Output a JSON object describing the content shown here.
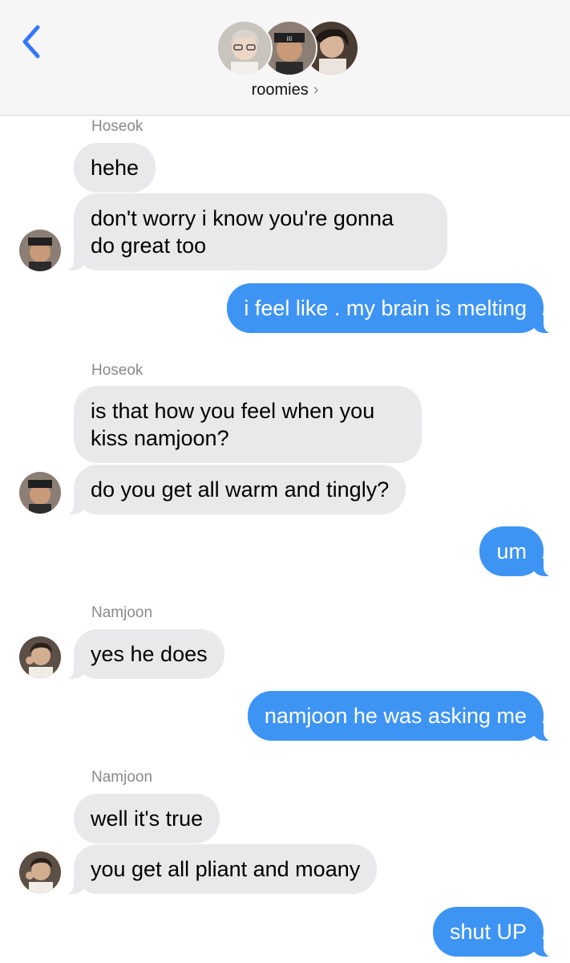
{
  "header": {
    "group_name": "roomies",
    "chevron": "›",
    "back_icon": "chevron-left-icon",
    "accent": "#3478f6"
  },
  "colors": {
    "incoming_bubble": "#e9e9eb",
    "outgoing_bubble": "#3e94f3",
    "sender_label": "#8a8a8e"
  },
  "messages": [
    {
      "sender": "Hoseok",
      "text": "hehe",
      "direction": "incoming"
    },
    {
      "text": "don't worry i know you're gonna",
      "text2": "do great too",
      "direction": "incoming"
    },
    {
      "text": "i feel like . my brain is melting",
      "direction": "outgoing"
    },
    {
      "sender": "Hoseok",
      "text": "is that how you feel when you",
      "text2": "kiss namjoon?",
      "direction": "incoming"
    },
    {
      "text": "do you get all warm and tingly?",
      "direction": "incoming"
    },
    {
      "text": "um",
      "direction": "outgoing"
    },
    {
      "sender": "Namjoon",
      "text": "yes he does",
      "direction": "incoming"
    },
    {
      "text": "namjoon he was asking me",
      "direction": "outgoing"
    },
    {
      "sender": "Namjoon",
      "text": "well it's true",
      "direction": "incoming"
    },
    {
      "text": "you get all pliant and moany",
      "direction": "incoming"
    },
    {
      "text": "shut UP",
      "direction": "outgoing"
    }
  ]
}
